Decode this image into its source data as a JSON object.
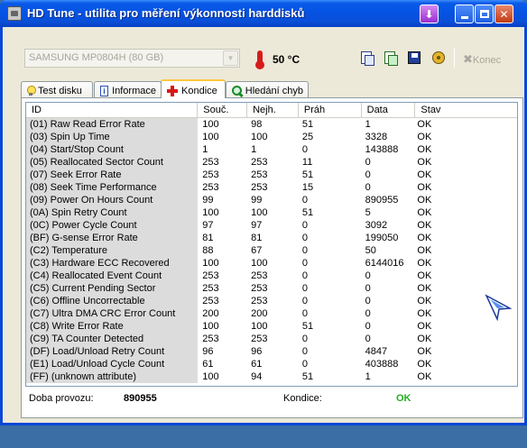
{
  "window": {
    "title": "HD Tune - utilita pro měření výkonnosti harddisků",
    "colors": {
      "title_bar": "#0553e3",
      "ok_green": "#1fae1f",
      "id_column_bg": "#dcdcdc"
    }
  },
  "toolbar": {
    "drive": "SAMSUNG MP0804H (80 GB)",
    "temperature": "50 °C",
    "exit_label": "Konec",
    "icons": [
      "copy-text-icon",
      "copy-screenshot-icon",
      "save-icon",
      "options-icon"
    ]
  },
  "tabs": [
    {
      "label": "Test disku",
      "icon": "bulb-icon",
      "active": false
    },
    {
      "label": "Informace",
      "icon": "info-icon",
      "active": false
    },
    {
      "label": "Kondice",
      "icon": "health-cross-icon",
      "active": true
    },
    {
      "label": "Hledání chyb",
      "icon": "magnifier-icon",
      "active": false
    }
  ],
  "table": {
    "columns": [
      "ID",
      "Souč.",
      "Nejh.",
      "Práh",
      "Data",
      "Stav"
    ],
    "rows": [
      [
        "(01) Raw Read Error Rate",
        "100",
        "98",
        "51",
        "1",
        "OK"
      ],
      [
        "(03) Spin Up Time",
        "100",
        "100",
        "25",
        "3328",
        "OK"
      ],
      [
        "(04) Start/Stop Count",
        "1",
        "1",
        "0",
        "143888",
        "OK"
      ],
      [
        "(05) Reallocated Sector Count",
        "253",
        "253",
        "11",
        "0",
        "OK"
      ],
      [
        "(07) Seek Error Rate",
        "253",
        "253",
        "51",
        "0",
        "OK"
      ],
      [
        "(08) Seek Time Performance",
        "253",
        "253",
        "15",
        "0",
        "OK"
      ],
      [
        "(09) Power On Hours Count",
        "99",
        "99",
        "0",
        "890955",
        "OK"
      ],
      [
        "(0A) Spin Retry Count",
        "100",
        "100",
        "51",
        "5",
        "OK"
      ],
      [
        "(0C) Power Cycle Count",
        "97",
        "97",
        "0",
        "3092",
        "OK"
      ],
      [
        "(BF) G-sense Error Rate",
        "81",
        "81",
        "0",
        "199050",
        "OK"
      ],
      [
        "(C2) Temperature",
        "88",
        "67",
        "0",
        "50",
        "OK"
      ],
      [
        "(C3) Hardware ECC Recovered",
        "100",
        "100",
        "0",
        "6144016",
        "OK"
      ],
      [
        "(C4) Reallocated Event Count",
        "253",
        "253",
        "0",
        "0",
        "OK"
      ],
      [
        "(C5) Current Pending Sector",
        "253",
        "253",
        "0",
        "0",
        "OK"
      ],
      [
        "(C6) Offline Uncorrectable",
        "253",
        "253",
        "0",
        "0",
        "OK"
      ],
      [
        "(C7) Ultra DMA CRC Error Count",
        "200",
        "200",
        "0",
        "0",
        "OK"
      ],
      [
        "(C8) Write Error Rate",
        "100",
        "100",
        "51",
        "0",
        "OK"
      ],
      [
        "(C9) TA Counter Detected",
        "253",
        "253",
        "0",
        "0",
        "OK"
      ],
      [
        "(DF) Load/Unload Retry Count",
        "96",
        "96",
        "0",
        "4847",
        "OK"
      ],
      [
        "(E1) Load/Unload Cycle Count",
        "61",
        "61",
        "0",
        "403888",
        "OK"
      ],
      [
        "(FF) (unknown attribute)",
        "100",
        "94",
        "51",
        "1",
        "OK"
      ]
    ]
  },
  "footer": {
    "power_on_label": "Doba provozu:",
    "power_on_value": "890955",
    "health_label": "Kondice:",
    "health_value": "OK"
  }
}
